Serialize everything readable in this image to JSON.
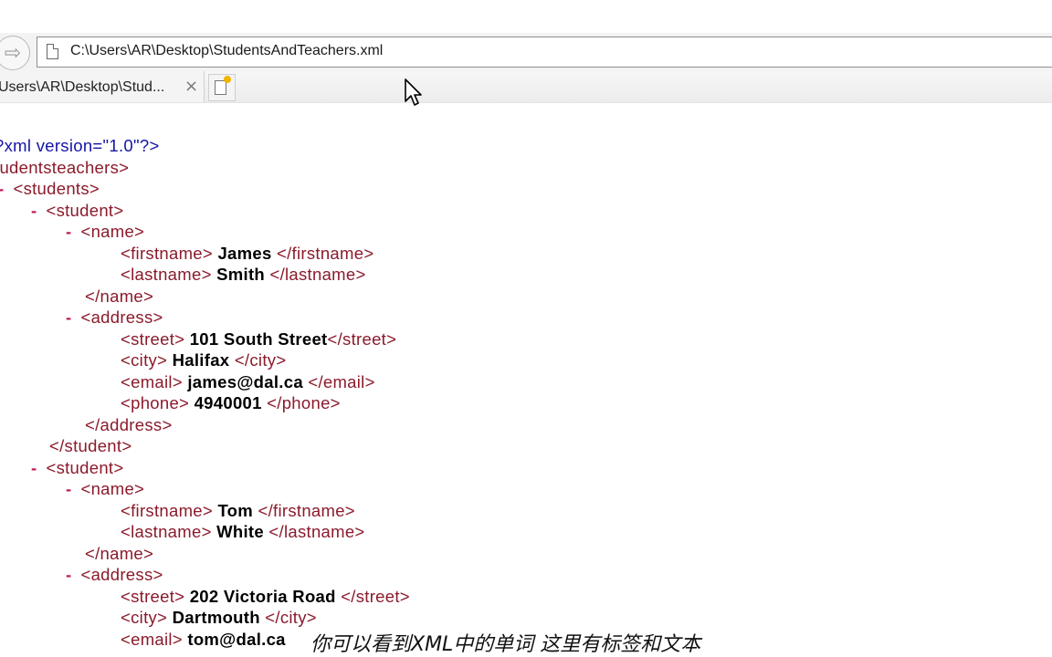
{
  "browser": {
    "address": "C:\\Users\\AR\\Desktop\\StudentsAndTeachers.xml",
    "tab_title": "Users\\AR\\Desktop\\Stud...",
    "tab_close": "×",
    "nav_arrow": "⇨"
  },
  "xml": {
    "lines": [
      {
        "indent": 0,
        "marker": "",
        "parts": [
          {
            "c": "pi",
            "t": "?xml version=\"1.0\"?>"
          }
        ]
      },
      {
        "indent": 0,
        "marker": "",
        "parts": [
          {
            "c": "tg",
            "t": "tudentsteachers>"
          }
        ]
      },
      {
        "indent": 0,
        "marker": "-",
        "parts": [
          {
            "c": "tg",
            "t": "<students>"
          }
        ]
      },
      {
        "indent": 1,
        "marker": "-",
        "parts": [
          {
            "c": "tg",
            "t": "<student>"
          }
        ]
      },
      {
        "indent": 2,
        "marker": "-",
        "parts": [
          {
            "c": "tg",
            "t": "<name>"
          }
        ]
      },
      {
        "indent": 3,
        "marker": "",
        "parts": [
          {
            "c": "tg",
            "t": "<firstname>"
          },
          {
            "c": "tx",
            "t": " James "
          },
          {
            "c": "tg",
            "t": "</firstname>"
          }
        ]
      },
      {
        "indent": 3,
        "marker": "",
        "parts": [
          {
            "c": "tg",
            "t": "<lastname>"
          },
          {
            "c": "tx",
            "t": " Smith "
          },
          {
            "c": "tg",
            "t": "</lastname>"
          }
        ]
      },
      {
        "indent": 2,
        "marker": "",
        "parts": [
          {
            "c": "tg",
            "t": "</name>"
          }
        ]
      },
      {
        "indent": 2,
        "marker": "-",
        "parts": [
          {
            "c": "tg",
            "t": "<address>"
          }
        ]
      },
      {
        "indent": 3,
        "marker": "",
        "parts": [
          {
            "c": "tg",
            "t": "<street>"
          },
          {
            "c": "tx",
            "t": " 101 South Street"
          },
          {
            "c": "tg",
            "t": "</street>"
          }
        ]
      },
      {
        "indent": 3,
        "marker": "",
        "parts": [
          {
            "c": "tg",
            "t": "<city>"
          },
          {
            "c": "tx",
            "t": " Halifax "
          },
          {
            "c": "tg",
            "t": "</city>"
          }
        ]
      },
      {
        "indent": 3,
        "marker": "",
        "parts": [
          {
            "c": "tg",
            "t": "<email>"
          },
          {
            "c": "tx",
            "t": " james@dal.ca "
          },
          {
            "c": "tg",
            "t": "</email>"
          }
        ]
      },
      {
        "indent": 3,
        "marker": "",
        "parts": [
          {
            "c": "tg",
            "t": "<phone>"
          },
          {
            "c": "tx",
            "t": " 4940001 "
          },
          {
            "c": "tg",
            "t": "</phone>"
          }
        ]
      },
      {
        "indent": 2,
        "marker": "",
        "parts": [
          {
            "c": "tg",
            "t": "</address>"
          }
        ]
      },
      {
        "indent": 1,
        "marker": "",
        "parts": [
          {
            "c": "tg",
            "t": "</student>"
          }
        ]
      },
      {
        "indent": 1,
        "marker": "-",
        "parts": [
          {
            "c": "tg",
            "t": "<student>"
          }
        ]
      },
      {
        "indent": 2,
        "marker": "-",
        "parts": [
          {
            "c": "tg",
            "t": "<name>"
          }
        ]
      },
      {
        "indent": 3,
        "marker": "",
        "parts": [
          {
            "c": "tg",
            "t": "<firstname>"
          },
          {
            "c": "tx",
            "t": " Tom "
          },
          {
            "c": "tg",
            "t": "</firstname>"
          }
        ]
      },
      {
        "indent": 3,
        "marker": "",
        "parts": [
          {
            "c": "tg",
            "t": "<lastname>"
          },
          {
            "c": "tx",
            "t": " White "
          },
          {
            "c": "tg",
            "t": "</lastname>"
          }
        ]
      },
      {
        "indent": 2,
        "marker": "",
        "parts": [
          {
            "c": "tg",
            "t": "</name>"
          }
        ]
      },
      {
        "indent": 2,
        "marker": "-",
        "parts": [
          {
            "c": "tg",
            "t": "<address>"
          }
        ]
      },
      {
        "indent": 3,
        "marker": "",
        "parts": [
          {
            "c": "tg",
            "t": "<street>"
          },
          {
            "c": "tx",
            "t": " 202 Victoria Road "
          },
          {
            "c": "tg",
            "t": "</street>"
          }
        ]
      },
      {
        "indent": 3,
        "marker": "",
        "parts": [
          {
            "c": "tg",
            "t": "<city>"
          },
          {
            "c": "tx",
            "t": " Dartmouth "
          },
          {
            "c": "tg",
            "t": "</city>"
          }
        ]
      },
      {
        "indent": 3,
        "marker": "",
        "parts": [
          {
            "c": "tg",
            "t": "<email>"
          },
          {
            "c": "tx",
            "t": " tom@dal.ca"
          }
        ]
      }
    ]
  },
  "subtitle": "你可以看到XML中的单词 这里有标签和文本",
  "colors": {
    "tag": "#8b1a2b",
    "processing_instruction": "#1414a6",
    "text": "#000000",
    "collapse_marker": "#c2185b"
  }
}
